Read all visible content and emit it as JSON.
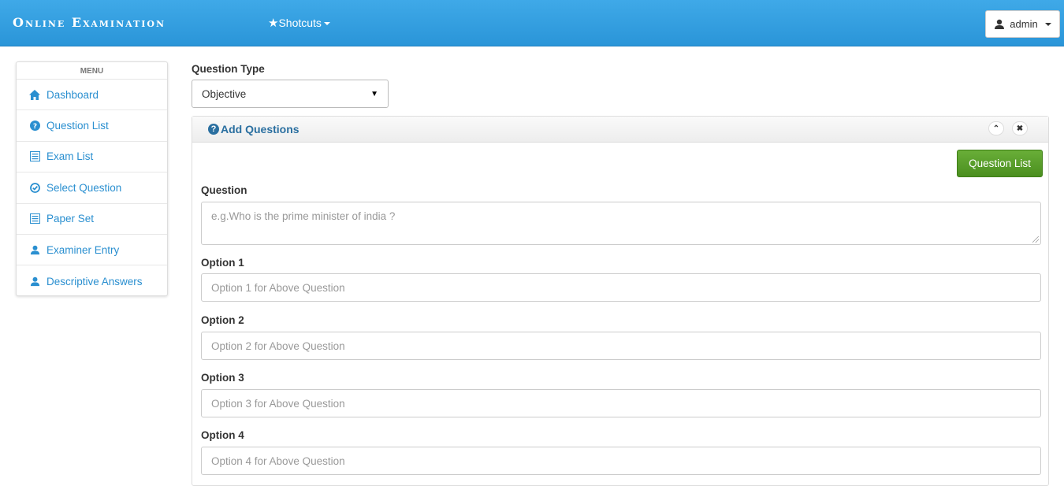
{
  "header": {
    "brand": "Online Examination",
    "shortcuts_label": "Shotcuts",
    "user_label": "admin"
  },
  "sidebar": {
    "title": "MENU",
    "items": [
      {
        "label": "Dashboard",
        "icon": "home-icon"
      },
      {
        "label": "Question List",
        "icon": "question-circle-icon"
      },
      {
        "label": "Exam List",
        "icon": "list-icon"
      },
      {
        "label": "Select Question",
        "icon": "check-circle-icon"
      },
      {
        "label": "Paper Set",
        "icon": "list-icon"
      },
      {
        "label": "Examiner Entry",
        "icon": "user-icon"
      },
      {
        "label": "Descriptive Answers",
        "icon": "user-icon"
      }
    ]
  },
  "form": {
    "question_type_label": "Question Type",
    "question_type_value": "Objective",
    "panel_title": "Add Questions",
    "question_list_button": "Question List",
    "question_label": "Question",
    "question_placeholder": "e.g.Who is the prime minister of india ?",
    "options": [
      {
        "label": "Option 1",
        "placeholder": "Option 1 for Above Question"
      },
      {
        "label": "Option 2",
        "placeholder": "Option 2 for Above Question"
      },
      {
        "label": "Option 3",
        "placeholder": "Option 3 for Above Question"
      },
      {
        "label": "Option 4",
        "placeholder": "Option 4 for Above Question"
      }
    ]
  },
  "colors": {
    "navbar": "#2a95d8",
    "link": "#2a8fd0",
    "success": "#5ba02c"
  }
}
